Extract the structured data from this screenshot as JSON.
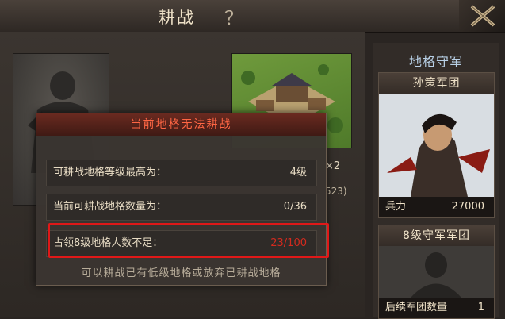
{
  "header": {
    "title": "耕战",
    "help_icon": "？",
    "close_icon": "close-icon"
  },
  "obscured": {
    "multiplier": "×2",
    "count_partial": "523)"
  },
  "right_panel": {
    "title": "地格守军",
    "card1": {
      "name": "孙策军团",
      "stat_label": "兵力",
      "stat_value": "27000"
    },
    "card2": {
      "name": "8级守军军团",
      "footer_label": "后续军团数量",
      "footer_value": "1"
    }
  },
  "dialog": {
    "title": "当前地格无法耕战",
    "rows": [
      {
        "label": "可耕战地格等级最高为：",
        "value": "4级"
      },
      {
        "label": "当前可耕战地格数量为：",
        "value": "0/36"
      },
      {
        "label": "占领8级地格人数不足：",
        "value": "23/100"
      }
    ],
    "footer": "可以耕战已有低级地格或放弃已耕战地格"
  },
  "colors": {
    "warning": "#d22a1e",
    "title_red": "#ff6644",
    "highlight_border": "#e01818",
    "panel_title_blue": "#b8d0e6"
  }
}
